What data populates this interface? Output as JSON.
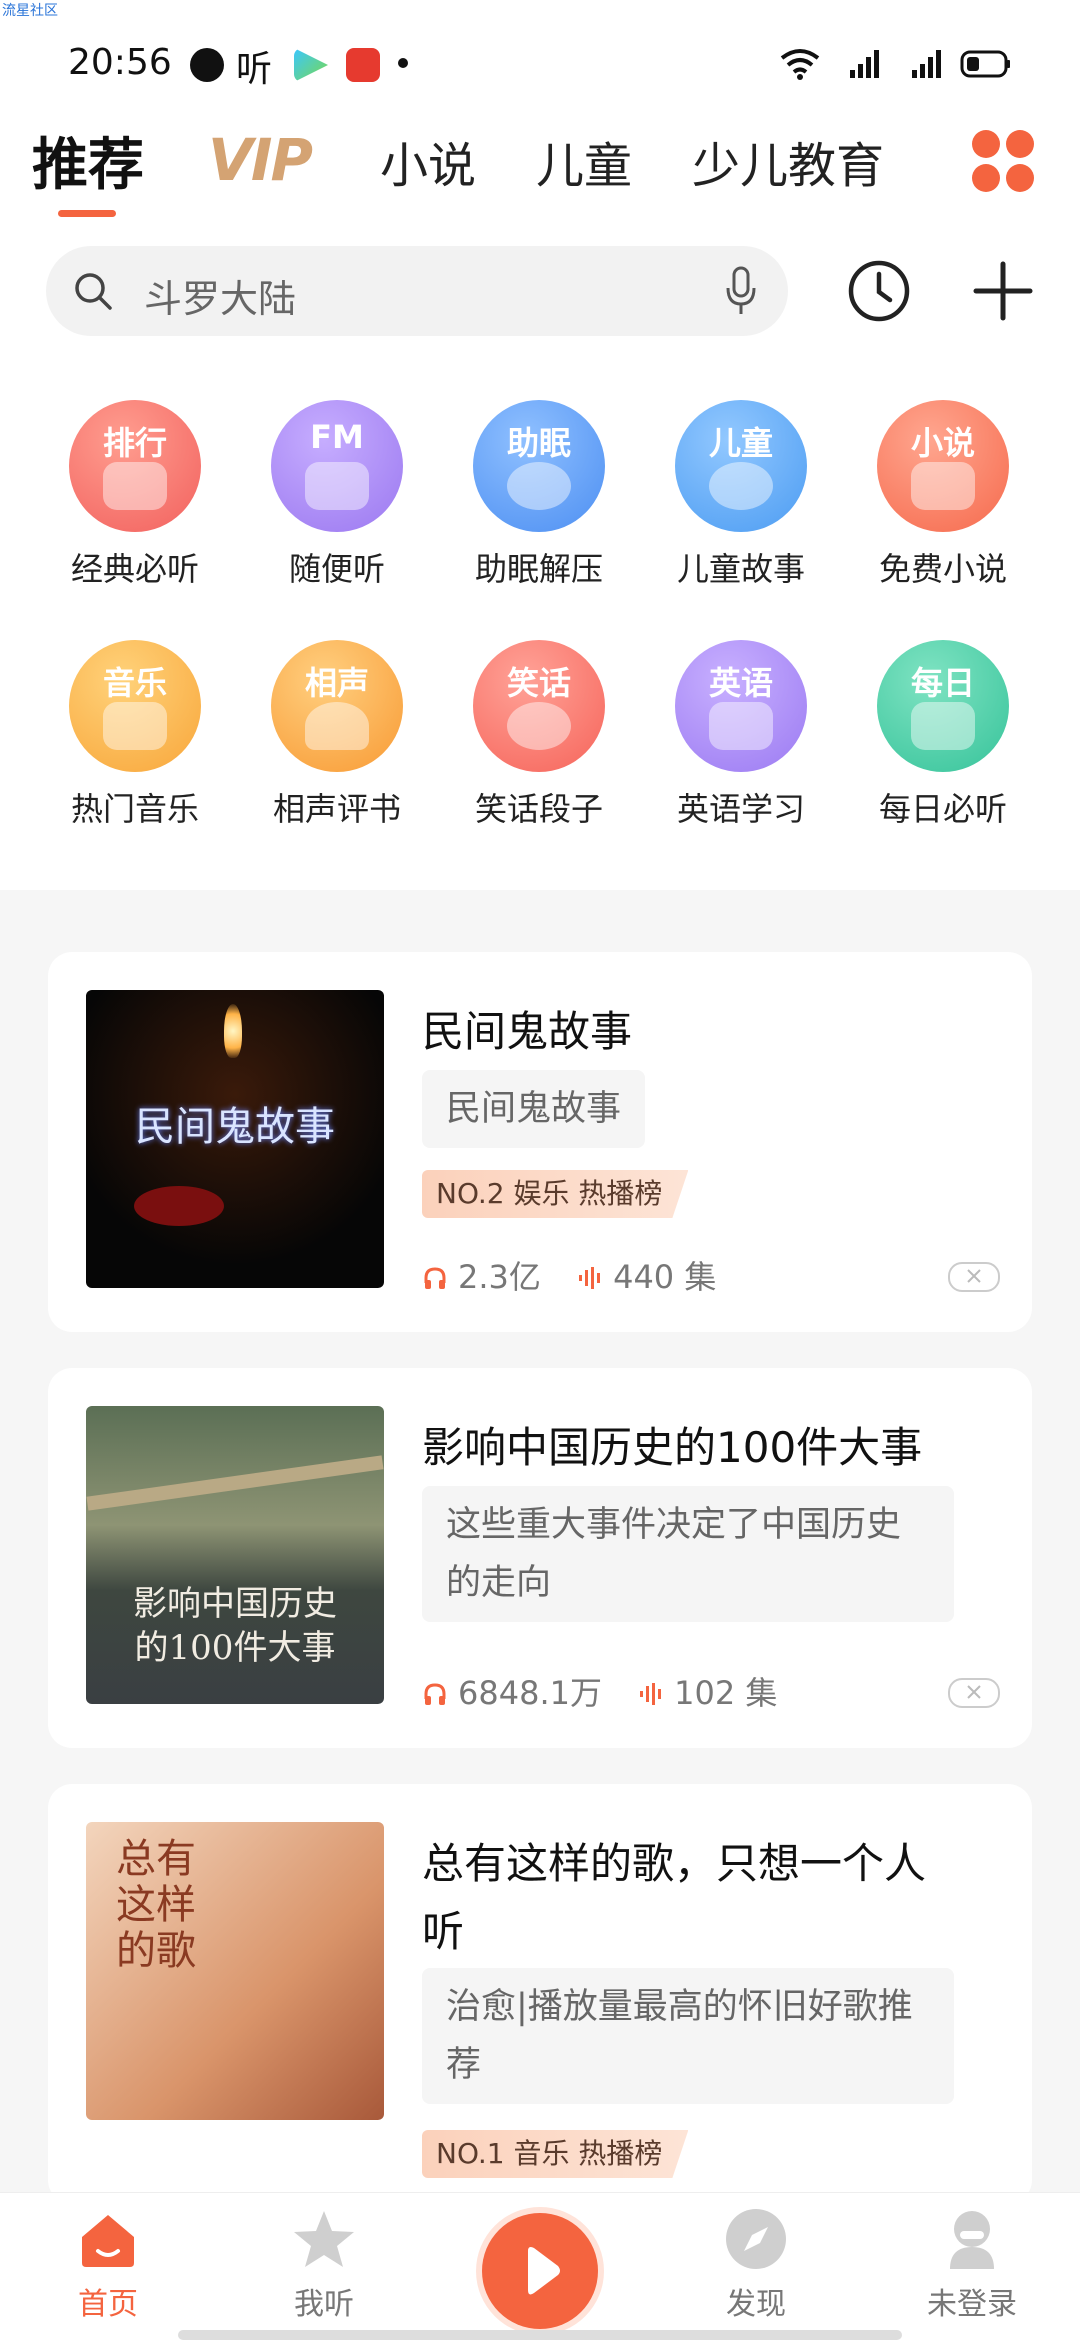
{
  "watermark": "流星社区",
  "status_bar": {
    "time": "20:56",
    "app_icon_text": "听"
  },
  "tabs": [
    {
      "label": "推荐",
      "active": true
    },
    {
      "label": "VIP",
      "active": false
    },
    {
      "label": "小说",
      "active": false
    },
    {
      "label": "儿童",
      "active": false
    },
    {
      "label": "少儿教育",
      "active": false
    }
  ],
  "search": {
    "placeholder": "斗罗大陆"
  },
  "categories": [
    {
      "tag": "排行",
      "label": "经典必听",
      "color": "#f2615e",
      "icon": "ranking-icon"
    },
    {
      "tag": "FM",
      "label": "随便听",
      "color": "#9b78f0",
      "icon": "radio-icon"
    },
    {
      "tag": "助眠",
      "label": "助眠解压",
      "color": "#4d8ff2",
      "icon": "moon-icon"
    },
    {
      "tag": "儿童",
      "label": "儿童故事",
      "color": "#4c9cf2",
      "icon": "child-icon"
    },
    {
      "tag": "小说",
      "label": "免费小说",
      "color": "#f66a4d",
      "icon": "book-icon"
    },
    {
      "tag": "音乐",
      "label": "热门音乐",
      "color": "#f8a63a",
      "icon": "music-note-icon"
    },
    {
      "tag": "相声",
      "label": "相声评书",
      "color": "#f89a34",
      "icon": "fan-icon"
    },
    {
      "tag": "笑话",
      "label": "笑话段子",
      "color": "#f6645a",
      "icon": "laugh-icon"
    },
    {
      "tag": "英语",
      "label": "英语学习",
      "color": "#9b7af2",
      "icon": "english-icon"
    },
    {
      "tag": "每日",
      "label": "每日必听",
      "color": "#36c39a",
      "icon": "calendar-icon"
    }
  ],
  "cards": [
    {
      "title": "民间鬼故事",
      "desc": "民间鬼故事",
      "badge": "NO.2 娱乐 热播榜",
      "plays": "2.3亿",
      "episodes": "440 集",
      "cover_text": "民间鬼故事"
    },
    {
      "title": "影响中国历史的100件大事",
      "desc": "这些重大事件决定了中国历史的走向",
      "plays": "6848.1万",
      "episodes": "102 集",
      "cover_text_line1": "影响中国历史",
      "cover_text_line2": "的100件大事"
    },
    {
      "title": "总有这样的歌，只想一个人听",
      "desc": "治愈|播放量最高的怀旧好歌推荐",
      "badge": "NO.1 音乐 热播榜",
      "cover_text_1": "总有",
      "cover_text_2": "这样",
      "cover_text_3": "的歌"
    }
  ],
  "bottom_nav": [
    {
      "label": "首页",
      "active": true,
      "icon": "home-icon"
    },
    {
      "label": "我听",
      "active": false,
      "icon": "star-icon"
    },
    {
      "label": "",
      "active": false,
      "icon": "play-icon"
    },
    {
      "label": "发现",
      "active": false,
      "icon": "compass-icon"
    },
    {
      "label": "未登录",
      "active": false,
      "icon": "user-icon"
    }
  ],
  "colors": {
    "accent": "#f4643f",
    "vip": "#d4a373",
    "badge_bg": "#fbd1bb"
  }
}
